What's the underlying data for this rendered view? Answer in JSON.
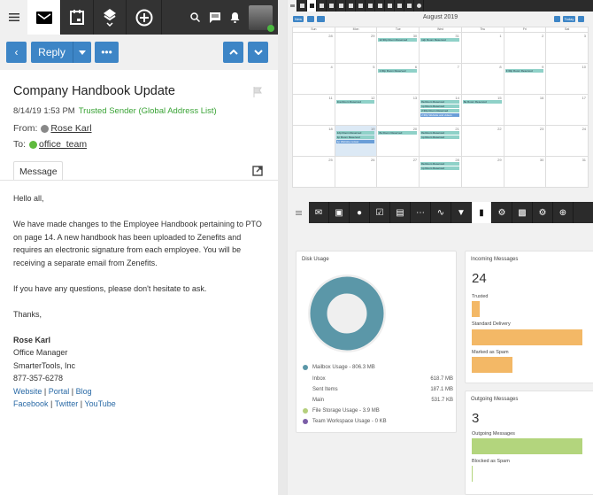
{
  "email": {
    "reply_label": "Reply",
    "subject": "Company Handbook Update",
    "timestamp": "8/14/19 1:53 PM",
    "trust": "Trusted Sender (Global Address List)",
    "from_label": "From:",
    "from": "Rose Karl",
    "to_label": "To:",
    "to": "office_team",
    "tab": "Message",
    "greeting": "Hello all,",
    "paragraph": "We have made changes to the Employee Handbook pertaining to PTO on page 14.  A new handbook has been uploaded to Zenefits and requires an electronic signature from each employee.  You will be receiving a separate email from Zenefits.",
    "questions": "If you have any questions, please don't hesitate to ask.",
    "thanks": "Thanks,",
    "sig_name": "Rose Karl",
    "sig_title": "Office Manager",
    "sig_company": "SmarterTools, Inc",
    "sig_phone": "877-357-6278",
    "links1": [
      "Website",
      "Portal",
      "Blog"
    ],
    "links2": [
      "Facebook",
      "Twitter",
      "YouTube"
    ]
  },
  "calendar": {
    "title": "August 2019",
    "new_label": "New",
    "today_label": "Today",
    "days": [
      "Sun",
      "Mon",
      "Tue",
      "Wed",
      "Thu",
      "Fri",
      "Sat"
    ],
    "weeks": [
      [
        "28",
        "29",
        "30",
        "31",
        "1",
        "2",
        "3"
      ],
      [
        "4",
        "5",
        "6",
        "7",
        "8",
        "9",
        "10"
      ],
      [
        "11",
        "12",
        "13",
        "14",
        "15",
        "16",
        "17"
      ],
      [
        "18",
        "19",
        "20",
        "21",
        "22",
        "23",
        "24"
      ],
      [
        "25",
        "26",
        "27",
        "28",
        "29",
        "30",
        "31"
      ]
    ],
    "events": {
      "tue_30": "12:30p Room Reserved",
      "wed_31": "12p Room Reserved",
      "tue_6": "1:30p Room Reserved",
      "fri_9": "3:30p Room Reserved",
      "mon_12": "11a Room Reserved",
      "wed_14": [
        "8a Room Reserved",
        "1p Room Reserved",
        "2:30p Room Reserved",
        "2:30p Website and videos"
      ],
      "thu_15": "8a Room Reserved",
      "mon_19": [
        "12p Room Reserved",
        "1p Room Reserved",
        "1p Website review"
      ],
      "tue_20": "8a Room Reserved",
      "wed_21": [
        "8a Room Reserved",
        "1p Room Reserved"
      ],
      "wed_28": [
        "8a Room Reserved",
        "1p Room Reserved"
      ]
    }
  },
  "dashboard": {
    "disk": {
      "title": "Disk Usage",
      "mailbox": "Mailbox Usage - 806.3 MB",
      "inbox_label": "Inbox",
      "inbox": "618.7 MB",
      "sent_label": "Sent Items",
      "sent": "187.1 MB",
      "main_label": "Main",
      "main": "531.7 KB",
      "files": "File Storage Usage - 3.9 MB",
      "team": "Team Workspace Usage - 0 KB",
      "colors": {
        "mailbox": "#5b97a8",
        "files": "#b5cf7d",
        "team": "#7b5ea7"
      }
    },
    "incoming": {
      "title": "Incoming Messages",
      "count": "24",
      "trusted_label": "Trusted",
      "trusted_frac": 0.07,
      "standard_label": "Standard Delivery",
      "standard_frac": 1.0,
      "spam_label": "Marked as Spam",
      "spam_frac": 0.37,
      "color": "#f3b866"
    },
    "outgoing": {
      "title": "Outgoing Messages",
      "count": "3",
      "out_label": "Outgoing Messages",
      "out_frac": 1.0,
      "blocked_label": "Blocked as Spam",
      "blocked_frac": 0.0,
      "color": "#b3d57d"
    }
  }
}
